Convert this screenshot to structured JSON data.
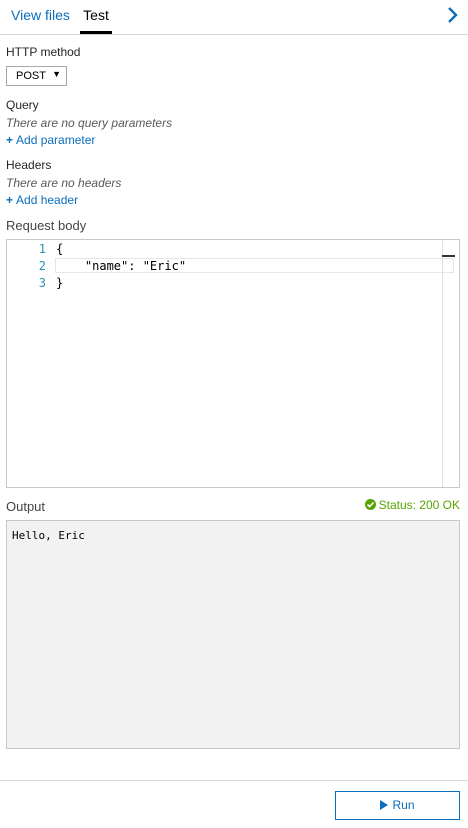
{
  "tabs": {
    "view_files": "View files",
    "test": "Test"
  },
  "icons": {
    "collapse": "chevron-right-icon",
    "add": "plus-icon",
    "status": "check-circle-icon",
    "run": "play-icon"
  },
  "http_method": {
    "label": "HTTP method",
    "selected": "POST"
  },
  "query": {
    "label": "Query",
    "empty_text": "There are no query parameters",
    "add_label": "Add parameter"
  },
  "headers": {
    "label": "Headers",
    "empty_text": "There are no headers",
    "add_label": "Add header"
  },
  "request_body": {
    "label": "Request body",
    "lines": [
      {
        "num": "1",
        "text": "{"
      },
      {
        "num": "2",
        "text": "    \"name\": \"Eric\""
      },
      {
        "num": "3",
        "text": "}"
      }
    ]
  },
  "output": {
    "label": "Output",
    "status": "Status: 200 OK",
    "text": "Hello, Eric"
  },
  "run_button": {
    "label": "Run"
  },
  "colors": {
    "accent": "#0a6ebd",
    "success": "#57a300",
    "line_number": "#2b91af"
  }
}
